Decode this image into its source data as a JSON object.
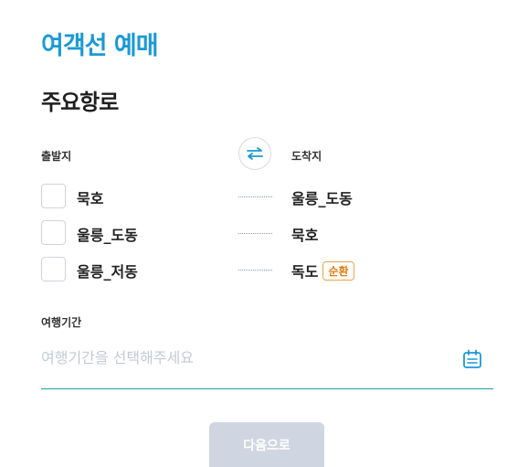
{
  "header": {
    "title": "여객선 예매"
  },
  "routes_section": {
    "title": "주요항로",
    "departure_label": "출발지",
    "arrival_label": "도착지",
    "swap_icon": "swap-arrows-icon",
    "rows": [
      {
        "departure": "묵호",
        "arrival": "울릉_도동",
        "badge": ""
      },
      {
        "departure": "울릉_도동",
        "arrival": "묵호",
        "badge": ""
      },
      {
        "departure": "울릉_저동",
        "arrival": "독도",
        "badge": "순환"
      }
    ]
  },
  "period": {
    "label": "여행기간",
    "placeholder": "여행기간을 선택해주세요",
    "icon": "calendar-icon"
  },
  "next_button": {
    "label": "다음으로"
  },
  "colors": {
    "accent": "#1a9ad6",
    "underline": "#1aa39a",
    "badge": "#e07a10",
    "button_disabled": "#cfd6e1"
  }
}
